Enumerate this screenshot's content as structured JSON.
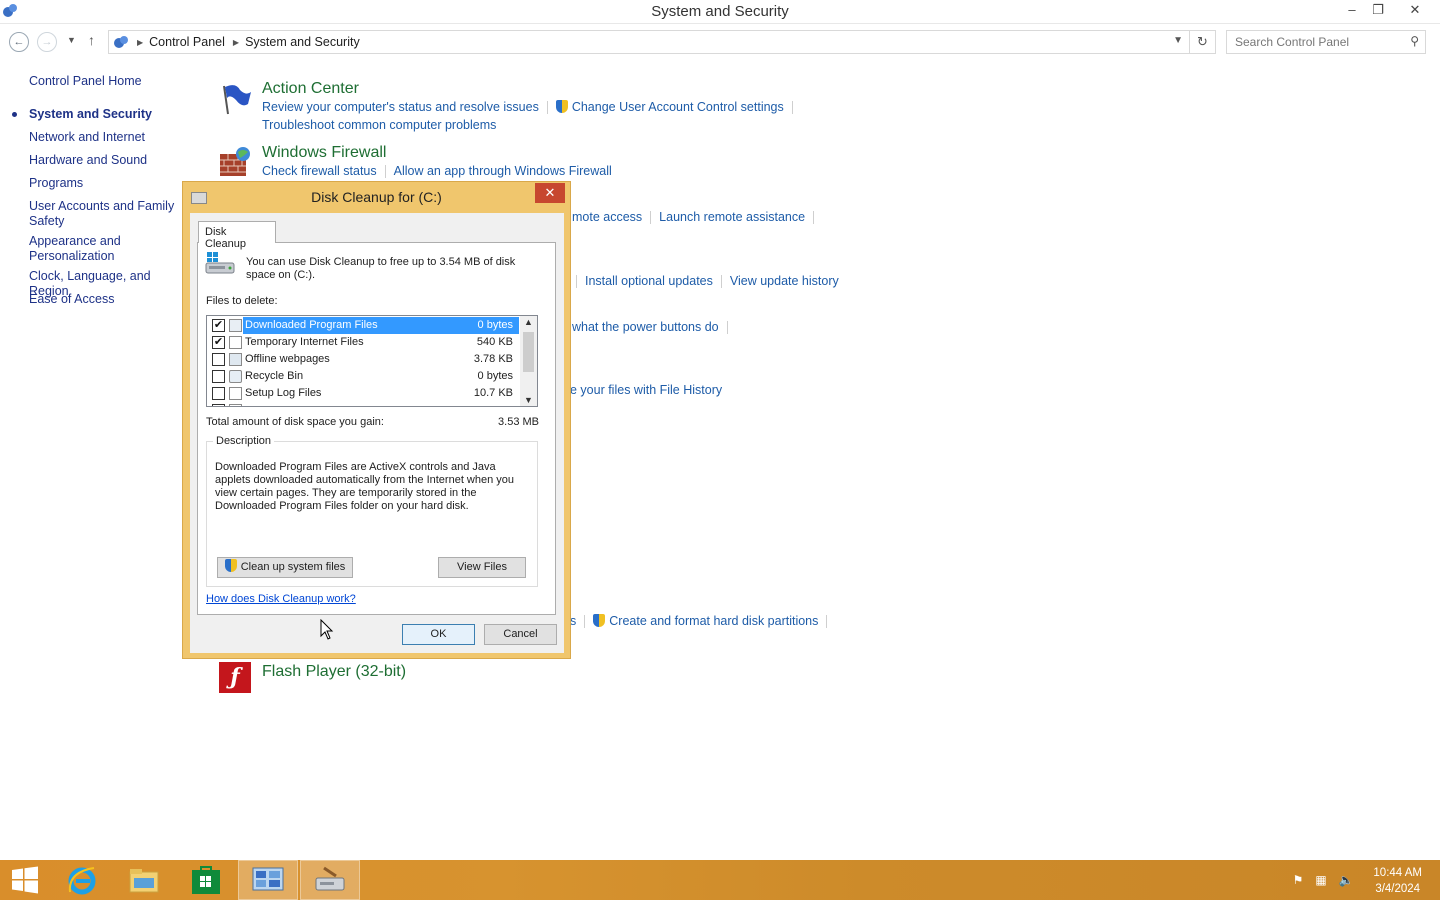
{
  "window": {
    "title": "System and Security",
    "minimize": "–",
    "restore": "❐",
    "close": "✕"
  },
  "address": {
    "crumbs": [
      "Control Panel",
      "System and Security"
    ],
    "search_placeholder": "Search Control Panel"
  },
  "leftnav": {
    "home": "Control Panel Home",
    "items": [
      "System and Security",
      "Network and Internet",
      "Hardware and Sound",
      "Programs",
      "User Accounts and Family Safety",
      "Appearance and Personalization",
      "Clock, Language, and Region",
      "Ease of Access"
    ],
    "current_index": 0
  },
  "sections": {
    "action_center": {
      "title": "Action Center",
      "links": [
        "Review your computer's status and resolve issues",
        "Change User Account Control settings",
        "Troubleshoot common computer problems"
      ]
    },
    "firewall": {
      "title": "Windows Firewall",
      "links": [
        "Check firewall status",
        "Allow an app through Windows Firewall"
      ]
    },
    "system_partial": {
      "links": [
        "mote access",
        "Launch remote assistance"
      ]
    },
    "update_partial": {
      "links": [
        "Install optional updates",
        "View update history"
      ]
    },
    "power_partial": {
      "links": [
        "what the power buttons do"
      ]
    },
    "history_partial": {
      "links": [
        "e your files with File History"
      ]
    },
    "admin_partial": {
      "links": [
        "s",
        "Create and format hard disk partitions"
      ]
    },
    "flash": {
      "title": "Flash Player (32-bit)"
    }
  },
  "dialog": {
    "title": "Disk Cleanup for  (C:)",
    "close": "✕",
    "tab": "Disk Cleanup",
    "intro": "You can use Disk Cleanup to free up to 3.54 MB of disk space on  (C:).",
    "files_label": "Files to delete:",
    "files": [
      {
        "name": "Downloaded Program Files",
        "size": "0 bytes",
        "checked": true,
        "selected": true
      },
      {
        "name": "Temporary Internet Files",
        "size": "540 KB",
        "checked": true,
        "selected": false
      },
      {
        "name": "Offline webpages",
        "size": "3.78 KB",
        "checked": false,
        "selected": false
      },
      {
        "name": "Recycle Bin",
        "size": "0 bytes",
        "checked": false,
        "selected": false
      },
      {
        "name": "Setup Log Files",
        "size": "10.7 KB",
        "checked": false,
        "selected": false
      }
    ],
    "total_label": "Total amount of disk space you gain:",
    "total_value": "3.53 MB",
    "description_legend": "Description",
    "description": "Downloaded Program Files are ActiveX controls and Java applets downloaded automatically from the Internet when you view certain pages. They are temporarily stored in the Downloaded Program Files folder on your hard disk.",
    "cleanup_system_button": "Clean up system files",
    "view_files_button": "View Files",
    "how_link": "How does Disk Cleanup work?",
    "ok_button": "OK",
    "cancel_button": "Cancel"
  },
  "taskbar": {
    "time": "10:44 AM",
    "date": "3/4/2024"
  }
}
